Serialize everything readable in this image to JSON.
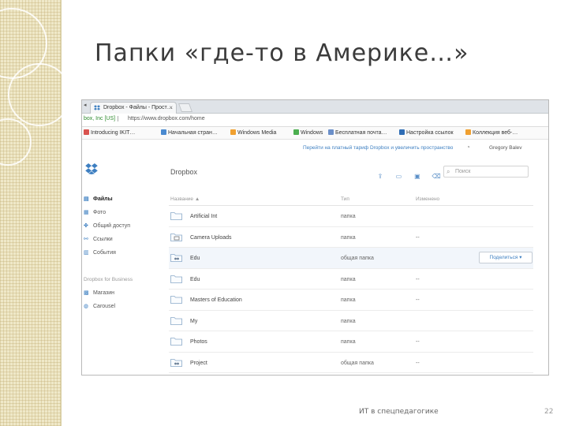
{
  "slide": {
    "title": "Папки «где-то в Америке…»",
    "footer": "ИТ в спецпедагогике",
    "page_number": "22"
  },
  "browser": {
    "tab_title": "Dropbox - Файлы - Прост…",
    "ev_badge": "box, Inc [US]",
    "url": "https://www.dropbox.com/home",
    "bookmarks": [
      "Introducing IKIT…",
      "Начальная стран…",
      "Windows Media",
      "Windows",
      "Бесплатная почта…",
      "Настройка ссылок",
      "Коллекция веб-…"
    ]
  },
  "dropbox": {
    "upgrade_link": "Перейти на платный тариф Dropbox и увеличить пространство",
    "user_name": "Gregory Balev",
    "heading": "Dropbox",
    "search_placeholder": "Поиск",
    "sidebar": {
      "items": [
        {
          "label": "Файлы",
          "icon": "files-icon"
        },
        {
          "label": "Фото",
          "icon": "photos-icon"
        },
        {
          "label": "Общий доступ",
          "icon": "sharing-icon"
        },
        {
          "label": "Ссылки",
          "icon": "links-icon"
        },
        {
          "label": "События",
          "icon": "events-icon"
        }
      ],
      "section_heading": "Dropbox for Business",
      "section_items": [
        {
          "label": "Магазин",
          "icon": "store-icon"
        },
        {
          "label": "Carousel",
          "icon": "carousel-icon"
        }
      ]
    },
    "columns": {
      "name": "Название ▲",
      "type": "Тип",
      "modified": "Изменено"
    },
    "files": [
      {
        "name": "Artificial Int",
        "type": "папка",
        "modified": "",
        "icon": "folder-icon"
      },
      {
        "name": "Camera Uploads",
        "type": "папка",
        "modified": "--",
        "icon": "camera-folder-icon"
      },
      {
        "name": "Edu",
        "type": "общая папка",
        "modified": "",
        "icon": "shared-folder-icon",
        "share": "Поделиться ▾"
      },
      {
        "name": "Edu",
        "type": "папка",
        "modified": "--",
        "icon": "folder-icon"
      },
      {
        "name": "Masters of Education",
        "type": "папка",
        "modified": "--",
        "icon": "folder-icon"
      },
      {
        "name": "My",
        "type": "папка",
        "modified": "",
        "icon": "folder-icon"
      },
      {
        "name": "Photos",
        "type": "папка",
        "modified": "--",
        "icon": "folder-icon"
      },
      {
        "name": "Project",
        "type": "общая папка",
        "modified": "--",
        "icon": "shared-folder-icon"
      }
    ]
  },
  "colors": {
    "accent": "#3d7fc1",
    "deco_strip": "#efe8c8"
  }
}
